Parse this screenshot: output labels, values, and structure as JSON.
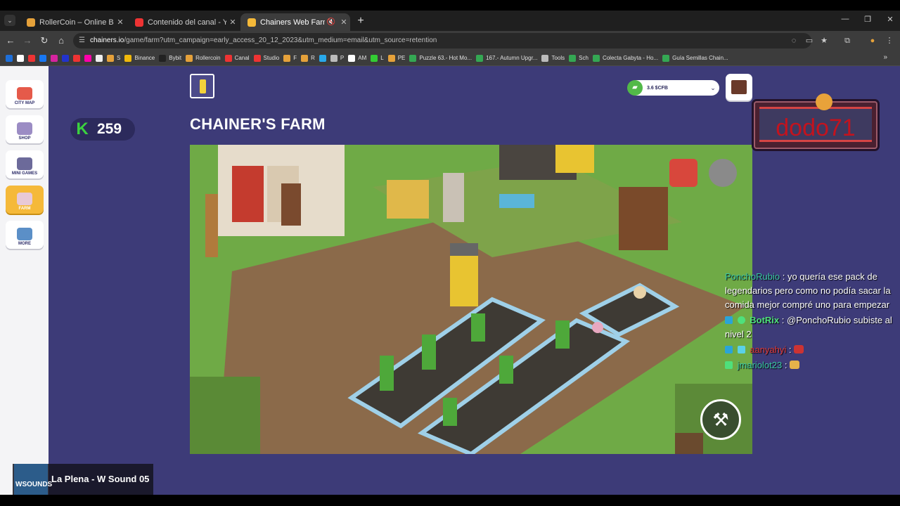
{
  "browser": {
    "tabs": [
      {
        "title": "RollerCoin – Online Bitcoin Mi",
        "close": "✕",
        "color": "#e5a13a",
        "active": false
      },
      {
        "title": "Contenido del canal - YouTube",
        "close": "✕",
        "color": "#e33",
        "active": false
      },
      {
        "title": "Chainers Web Farm",
        "close": "✕",
        "color": "#f5b939",
        "active": true
      }
    ],
    "new_tab": "+",
    "url_host": "chainers.io",
    "url_path": "/game/farm?utm_campaign=early_access_20_12_2023&utm_medium=email&utm_source=retention",
    "bookmarks": [
      {
        "label": "",
        "color": "#1e6fd9"
      },
      {
        "label": "",
        "color": "#fff"
      },
      {
        "label": "",
        "color": "#e33"
      },
      {
        "label": "",
        "color": "#1877f2"
      },
      {
        "label": "",
        "color": "#d6249f"
      },
      {
        "label": "",
        "color": "#23c"
      },
      {
        "label": "",
        "color": "#e33"
      },
      {
        "label": "",
        "color": "#f0a"
      },
      {
        "label": "",
        "color": "#eee"
      },
      {
        "label": "S",
        "color": "#e5a13a"
      },
      {
        "label": "Binance",
        "color": "#f0b90b"
      },
      {
        "label": "Bybit",
        "color": "#222"
      },
      {
        "label": "Rollercoin",
        "color": "#e5a13a"
      },
      {
        "label": "Canal",
        "color": "#e33"
      },
      {
        "label": "Studio",
        "color": "#e33"
      },
      {
        "label": "F",
        "color": "#e5a13a"
      },
      {
        "label": "R",
        "color": "#e5a13a"
      },
      {
        "label": "",
        "color": "#29a9eb"
      },
      {
        "label": "P",
        "color": "#bbb"
      },
      {
        "label": "AM",
        "color": "#fff"
      },
      {
        "label": "L",
        "color": "#3c3"
      },
      {
        "label": "PE",
        "color": "#e5a13a"
      },
      {
        "label": "Puzzle 63.- Hot Mo...",
        "color": "#34a853"
      },
      {
        "label": "167.- Autumn Upgr...",
        "color": "#34a853"
      },
      {
        "label": "Tools",
        "color": "#bbb"
      },
      {
        "label": "Sch",
        "color": "#34a853"
      },
      {
        "label": "Colecta Gabyta - Ho...",
        "color": "#34a853"
      },
      {
        "label": "Guía Semillas Chain...",
        "color": "#34a853"
      }
    ],
    "bookmarks_more": "»"
  },
  "sidebar": {
    "items": [
      {
        "label": "CITY MAP",
        "icon": "map-pin-icon",
        "color": "#e55a4a"
      },
      {
        "label": "SHOP",
        "icon": "shop-icon",
        "color": "#9b8cc4"
      },
      {
        "label": "MINI GAMES",
        "icon": "gamepad-icon",
        "color": "#6c6a9a"
      },
      {
        "label": "FARM",
        "icon": "cow-icon",
        "color": "#e8c9d6"
      },
      {
        "label": "MORE",
        "icon": "grid-icon",
        "color": "#5b8fc7"
      }
    ],
    "active": "FARM"
  },
  "overlay": {
    "k_symbol": "K",
    "coin_count": "259",
    "streamer": "dodo71"
  },
  "header": {
    "title": "CHAINER'S FARM",
    "currency_value": "3.6 $CFB",
    "currency_chevron": "⌄"
  },
  "game": {
    "hammer": "⚒",
    "icons": [
      "barn-icon",
      "settings-icon"
    ]
  },
  "chat": [
    {
      "user": "PonchoRubio",
      "sep": ":",
      "text": "yo quería ese pack de legendarios pero como no podía sacar la comida mejor compré uno para empezar"
    },
    {
      "user": "BotRix",
      "sep": ":",
      "text": "@PonchoRubio subiste al nivel 2"
    },
    {
      "user": "aanyahyi",
      "sep": ":",
      "text": ""
    },
    {
      "user": "jmariolot23",
      "sep": ":",
      "text": ""
    }
  ],
  "now_playing": {
    "thumb_text": "WSOUNDS",
    "title": "La Plena - W Sound 05"
  }
}
